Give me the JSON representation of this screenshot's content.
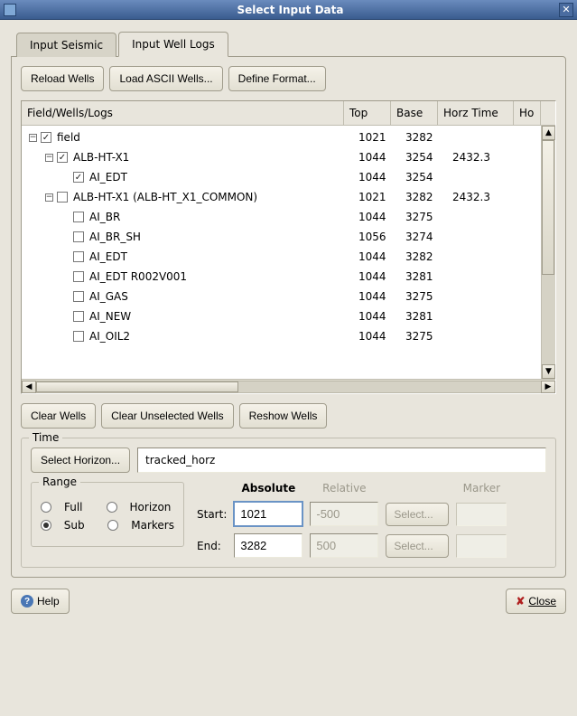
{
  "window": {
    "title": "Select Input Data"
  },
  "tabs": [
    {
      "label": "Input Seismic",
      "active": false
    },
    {
      "label": "Input Well Logs",
      "active": true
    }
  ],
  "toolbar1": {
    "reload": "Reload Wells",
    "load_ascii": "Load ASCII Wells...",
    "define_format": "Define Format..."
  },
  "tree": {
    "headers": {
      "field": "Field/Wells/Logs",
      "top": "Top",
      "base": "Base",
      "horz": "Horz Time",
      "extra": "Ho"
    },
    "rows": [
      {
        "indent": 0,
        "toggle": "-",
        "checked": true,
        "label": "field",
        "top": "1021",
        "base": "3282",
        "horz": ""
      },
      {
        "indent": 1,
        "toggle": "-",
        "checked": true,
        "label": "ALB-HT-X1",
        "top": "1044",
        "base": "3254",
        "horz": "2432.3"
      },
      {
        "indent": 2,
        "toggle": "",
        "checked": true,
        "label": "AI_EDT",
        "top": "1044",
        "base": "3254",
        "horz": ""
      },
      {
        "indent": 1,
        "toggle": "-",
        "checked": false,
        "label": "ALB-HT-X1 (ALB-HT_X1_COMMON)",
        "top": "1021",
        "base": "3282",
        "horz": "2432.3"
      },
      {
        "indent": 2,
        "toggle": "",
        "checked": false,
        "label": "AI_BR",
        "top": "1044",
        "base": "3275",
        "horz": ""
      },
      {
        "indent": 2,
        "toggle": "",
        "checked": false,
        "label": "AI_BR_SH",
        "top": "1056",
        "base": "3274",
        "horz": ""
      },
      {
        "indent": 2,
        "toggle": "",
        "checked": false,
        "label": "AI_EDT",
        "top": "1044",
        "base": "3282",
        "horz": ""
      },
      {
        "indent": 2,
        "toggle": "",
        "checked": false,
        "label": "AI_EDT R002V001",
        "top": "1044",
        "base": "3281",
        "horz": ""
      },
      {
        "indent": 2,
        "toggle": "",
        "checked": false,
        "label": "AI_GAS",
        "top": "1044",
        "base": "3275",
        "horz": ""
      },
      {
        "indent": 2,
        "toggle": "",
        "checked": false,
        "label": "AI_NEW",
        "top": "1044",
        "base": "3281",
        "horz": ""
      },
      {
        "indent": 2,
        "toggle": "",
        "checked": false,
        "label": "AI_OIL2",
        "top": "1044",
        "base": "3275",
        "horz": ""
      }
    ]
  },
  "toolbar2": {
    "clear_wells": "Clear Wells",
    "clear_unselected": "Clear Unselected Wells",
    "reshow": "Reshow Wells"
  },
  "time": {
    "label": "Time",
    "select_horizon": "Select Horizon...",
    "horizon_value": "tracked_horz",
    "range": {
      "label": "Range",
      "full": "Full",
      "horizon": "Horizon",
      "sub": "Sub",
      "markers": "Markers",
      "selected": "Sub"
    },
    "columns": {
      "absolute": "Absolute",
      "relative": "Relative",
      "marker": "Marker"
    },
    "start": {
      "label": "Start:",
      "abs": "1021",
      "rel": "-500",
      "select": "Select..."
    },
    "end": {
      "label": "End:",
      "abs": "3282",
      "rel": "500",
      "select": "Select..."
    }
  },
  "footer": {
    "help": "Help",
    "close": "Close"
  }
}
